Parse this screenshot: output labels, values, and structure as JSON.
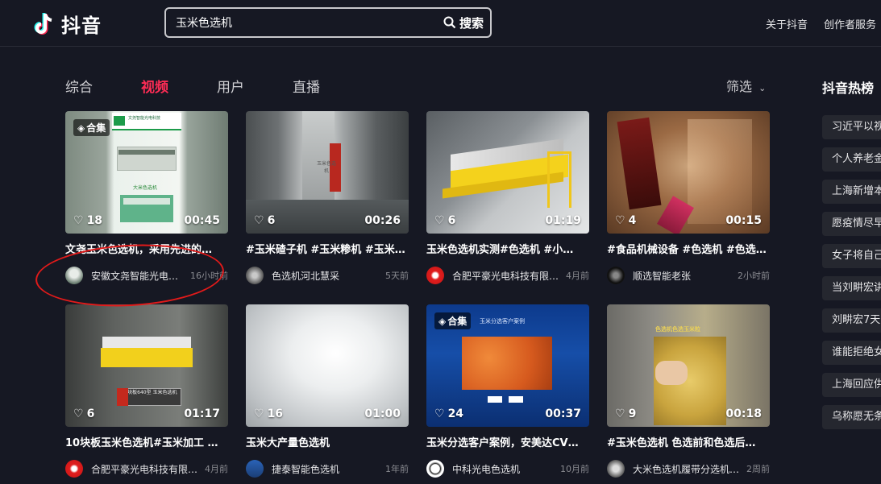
{
  "header": {
    "app_name": "抖音",
    "search_value": "玉米色选机",
    "search_button": "搜索",
    "links": [
      "关于抖音",
      "创作者服务"
    ]
  },
  "tabs": [
    {
      "label": "综合",
      "active": false
    },
    {
      "label": "视频",
      "active": true
    },
    {
      "label": "用户",
      "active": false
    },
    {
      "label": "直播",
      "active": false
    }
  ],
  "filter_label": "筛选",
  "hot": {
    "title": "抖音热榜",
    "items": [
      "习近平以视",
      "个人养老金",
      "上海新增本",
      "愿疫情尽早",
      "女子将自己",
      "当刘畊宏讲",
      "刘畊宏7天",
      "谁能拒绝女",
      "上海回应供",
      "乌称愿无条"
    ]
  },
  "videos": [
    {
      "likes": "18",
      "duration": "00:45",
      "badge": "合集",
      "title": "文尧玉米色选机，采用先进的…",
      "author": "安徽文尧智能光电…",
      "time": "16小时前"
    },
    {
      "likes": "6",
      "duration": "00:26",
      "badge": "",
      "title": "#玉米碴子机 #玉米糁机 #玉米…",
      "author": "色选机河北慧采",
      "time": "5天前"
    },
    {
      "likes": "6",
      "duration": "01:19",
      "badge": "",
      "title": "玉米色选机实测#色选机 #小…",
      "author": "合肥平豪光电科技有限…",
      "time": "4月前"
    },
    {
      "likes": "4",
      "duration": "00:15",
      "badge": "",
      "title": "#食品机械设备 #色选机 #色选…",
      "author": "顺选智能老张",
      "time": "2小时前"
    },
    {
      "likes": "6",
      "duration": "01:17",
      "badge": "",
      "title": "10块板玉米色选机#玉米加工 …",
      "author": "合肥平豪光电科技有限…",
      "time": "4月前"
    },
    {
      "likes": "16",
      "duration": "01:00",
      "badge": "",
      "title": "玉米大产量色选机",
      "author": "捷泰智能色选机",
      "time": "1年前"
    },
    {
      "likes": "24",
      "duration": "00:37",
      "badge": "合集",
      "title": "玉米分选客户案例，安美达CV…",
      "author": "中科光电色选机",
      "time": "10月前"
    },
    {
      "likes": "9",
      "duration": "00:18",
      "badge": "",
      "title": "#玉米色选机 色选前和色选后…",
      "author": "大米色选机履带分选机…",
      "time": "2周前"
    }
  ],
  "thumb_text": {
    "v1_banner": "文尧智能光电科技",
    "v1_caption": "大米色选机",
    "v2_sign": "玉米色选机",
    "v5_sign": "10块板640型 玉米色选机",
    "v7_banner": "玉米分选客户案例",
    "v8_banner": "色选机色选玉米粒"
  },
  "colors": {
    "background": "#161823",
    "accent": "#fe2c55",
    "annotation_circle": "#e11a1a"
  }
}
